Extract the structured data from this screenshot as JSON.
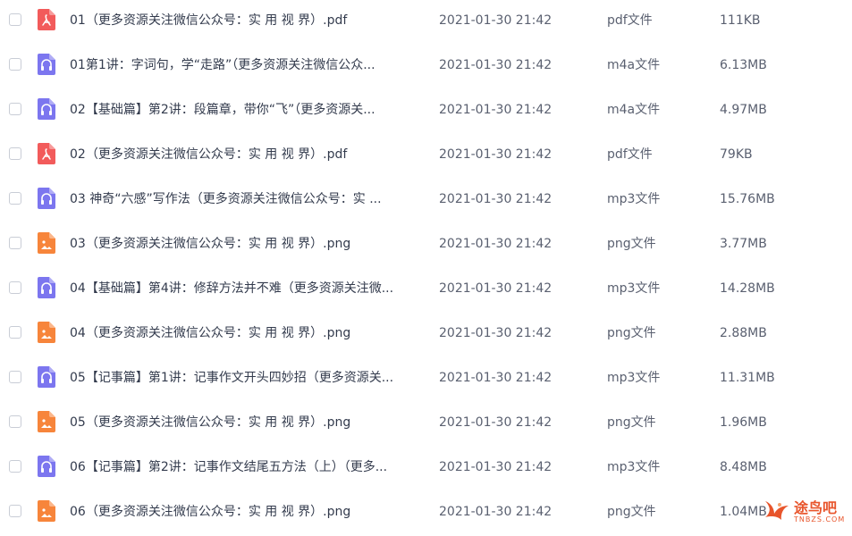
{
  "colors": {
    "pdf": "#f25b5b",
    "audio": "#7c76ef",
    "image": "#f7853b",
    "watermark": "#e8552c"
  },
  "files": [
    {
      "name": "01（更多资源关注微信公众号：实 用 视 界）.pdf",
      "date": "2021-01-30 21:42",
      "type": "pdf文件",
      "size": "111KB",
      "icon": "pdf-icon"
    },
    {
      "name": "01第1讲：字词句，学“走路”（更多资源关注微信公众...",
      "date": "2021-01-30 21:42",
      "type": "m4a文件",
      "size": "6.13MB",
      "icon": "audio-icon"
    },
    {
      "name": "02【基础篇】第2讲：段篇章，带你“飞”（更多资源关...",
      "date": "2021-01-30 21:42",
      "type": "m4a文件",
      "size": "4.97MB",
      "icon": "audio-icon"
    },
    {
      "name": "02（更多资源关注微信公众号：实 用 视 界）.pdf",
      "date": "2021-01-30 21:42",
      "type": "pdf文件",
      "size": "79KB",
      "icon": "pdf-icon"
    },
    {
      "name": "03 神奇“六感”写作法（更多资源关注微信公众号：实 ...",
      "date": "2021-01-30 21:42",
      "type": "mp3文件",
      "size": "15.76MB",
      "icon": "audio-icon"
    },
    {
      "name": "03（更多资源关注微信公众号：实 用 视 界）.png",
      "date": "2021-01-30 21:42",
      "type": "png文件",
      "size": "3.77MB",
      "icon": "image-icon"
    },
    {
      "name": "04【基础篇】第4讲：修辞方法并不难（更多资源关注微...",
      "date": "2021-01-30 21:42",
      "type": "mp3文件",
      "size": "14.28MB",
      "icon": "audio-icon"
    },
    {
      "name": "04（更多资源关注微信公众号：实 用 视 界）.png",
      "date": "2021-01-30 21:42",
      "type": "png文件",
      "size": "2.88MB",
      "icon": "image-icon"
    },
    {
      "name": "05【记事篇】第1讲：记事作文开头四妙招（更多资源关...",
      "date": "2021-01-30 21:42",
      "type": "mp3文件",
      "size": "11.31MB",
      "icon": "audio-icon"
    },
    {
      "name": "05（更多资源关注微信公众号：实 用 视 界）.png",
      "date": "2021-01-30 21:42",
      "type": "png文件",
      "size": "1.96MB",
      "icon": "image-icon"
    },
    {
      "name": "06【记事篇】第2讲：记事作文结尾五方法（上）（更多...",
      "date": "2021-01-30 21:42",
      "type": "mp3文件",
      "size": "8.48MB",
      "icon": "audio-icon"
    },
    {
      "name": "06（更多资源关注微信公众号：实 用 视 界）.png",
      "date": "2021-01-30 21:42",
      "type": "png文件",
      "size": "1.04MB",
      "icon": "image-icon"
    }
  ],
  "watermark": {
    "text": "途鸟吧",
    "sub": "TNBZS.COM"
  }
}
